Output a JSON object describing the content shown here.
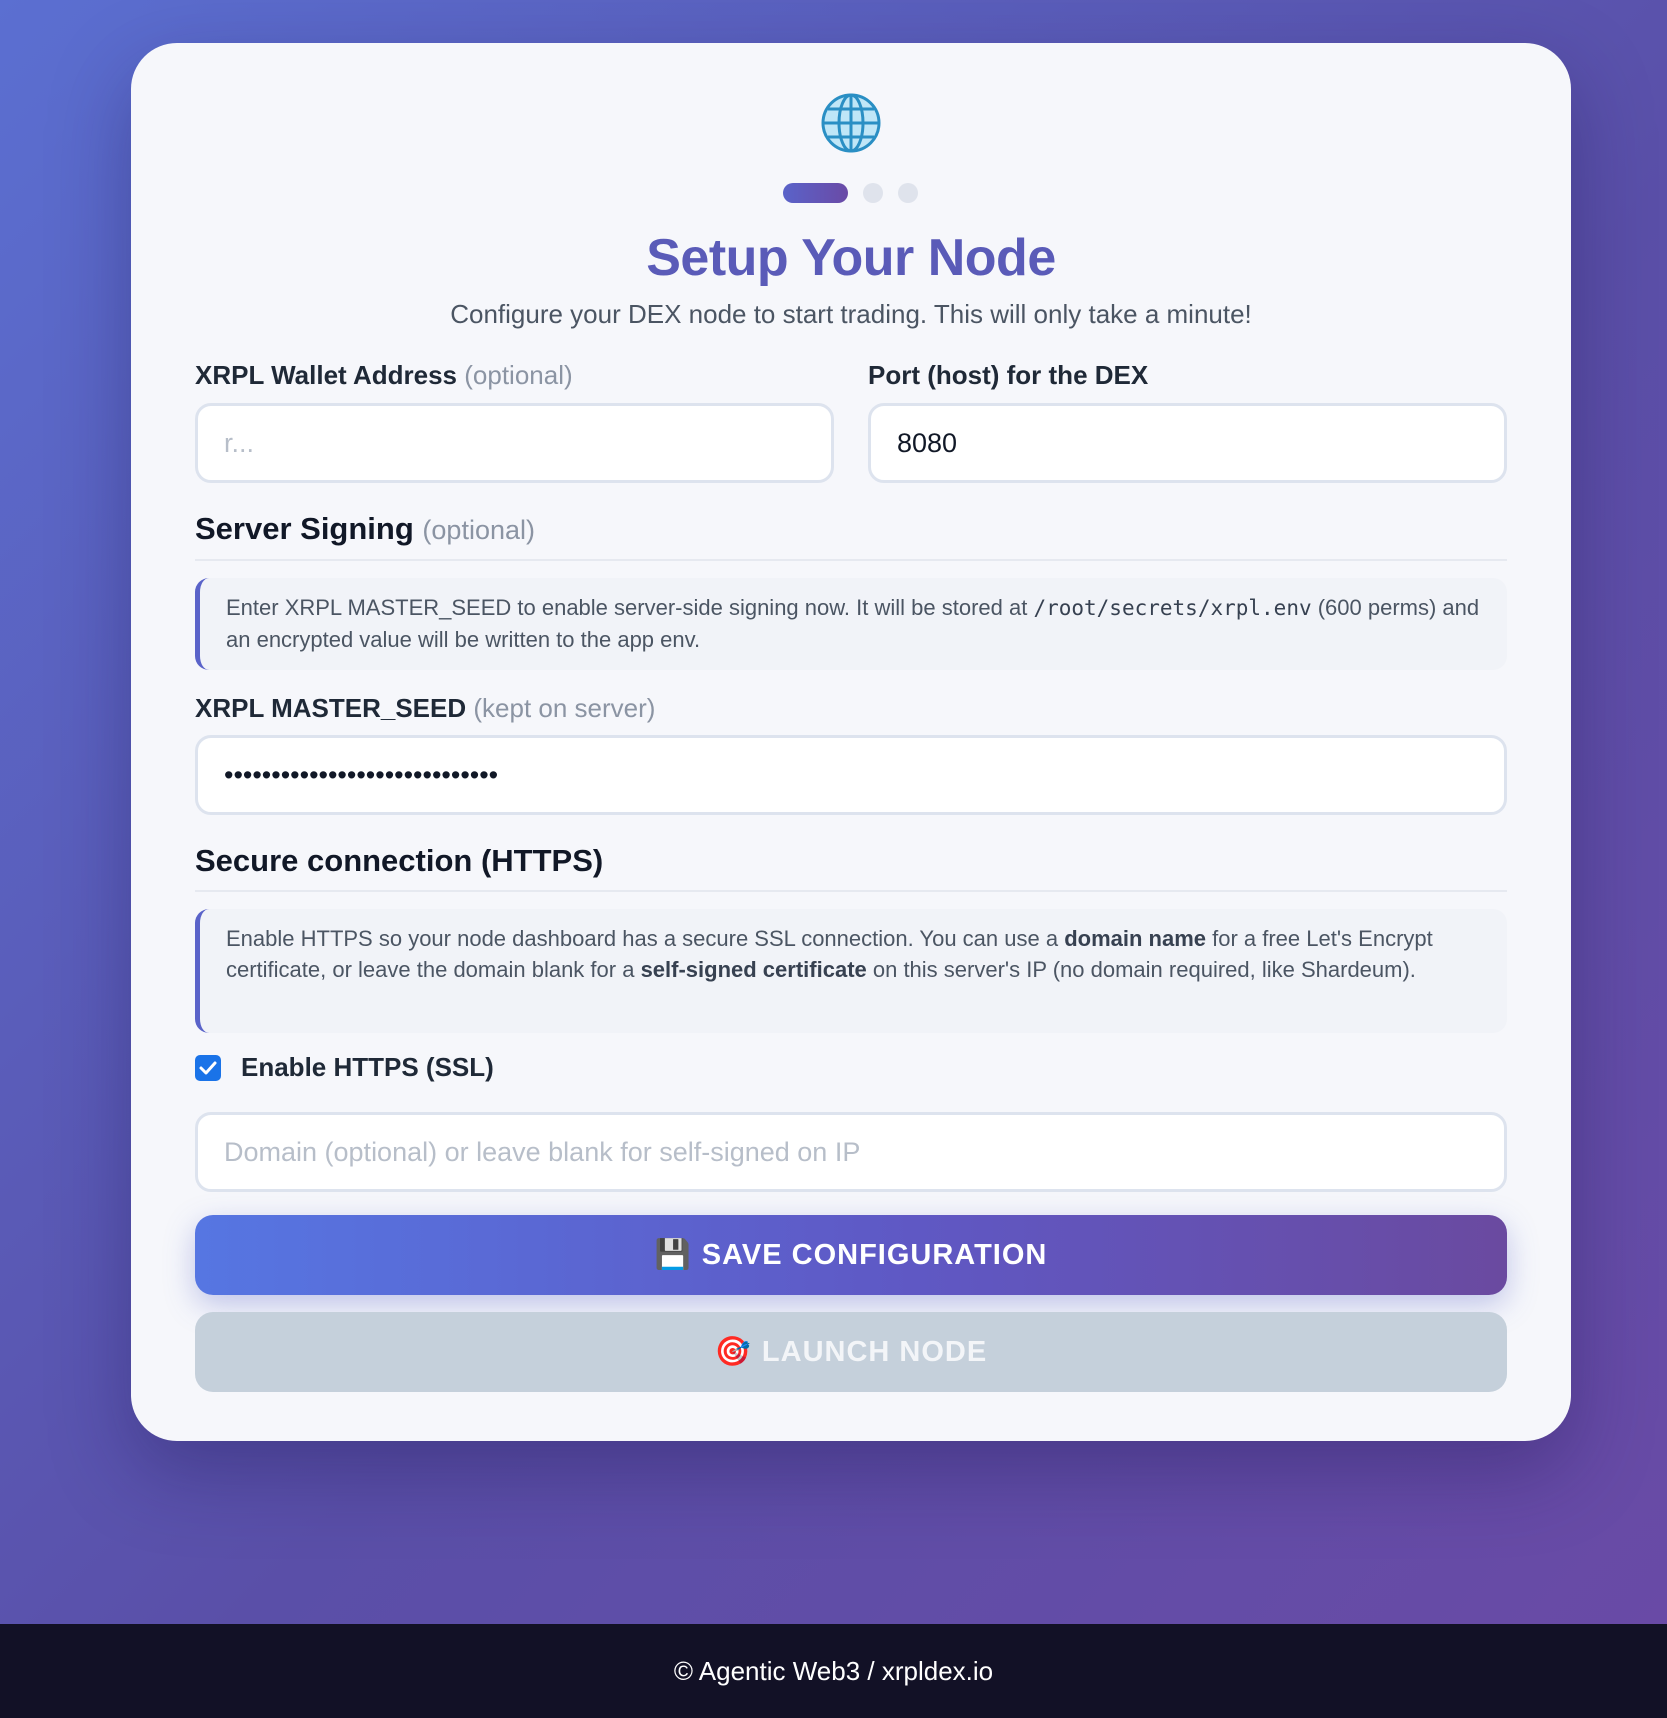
{
  "header": {
    "icon": "globe-icon",
    "title": "Setup Your Node",
    "subtitle": "Configure your DEX node to start trading. This will only take a minute!",
    "steps_total": 3,
    "steps_active": 1
  },
  "form": {
    "wallet": {
      "label": "XRPL Wallet Address",
      "hint": "(optional)",
      "placeholder": "r...",
      "value": ""
    },
    "port": {
      "label": "Port (host) for the DEX",
      "value": "8080"
    },
    "signing": {
      "title": "Server Signing",
      "hint": "(optional)",
      "notice_pre": "Enter XRPL MASTER_SEED to enable server-side signing now. It will be stored at ",
      "notice_path": "/root/secrets/xrpl.env",
      "notice_post": " (600 perms) and an encrypted value will be written to the app env.",
      "seed_label": "XRPL MASTER_SEED",
      "seed_hint": "(kept on server)",
      "seed_value": "sXXXXXXXXXXXXXXXXXXXXXXXXXXXX"
    },
    "https": {
      "title": "Secure connection (HTTPS)",
      "notice_1": "Enable HTTPS so your node dashboard has a secure SSL connection. You can use a ",
      "notice_b1": "domain name",
      "notice_2": " for a free Let's Encrypt certificate, or leave the domain blank for a ",
      "notice_b2": "self-signed certificate",
      "notice_3": " on this server's IP (no domain required, like Shardeum).",
      "checkbox_label": "Enable HTTPS (SSL)",
      "checked": true,
      "domain_placeholder": "Domain (optional) or leave blank for self-signed on IP"
    }
  },
  "buttons": {
    "save": {
      "icon": "floppy-disk-icon",
      "glyph": "💾",
      "label": "SAVE CONFIGURATION"
    },
    "launch": {
      "icon": "target-icon",
      "glyph": "🎯",
      "label": "LAUNCH NODE"
    }
  },
  "footer": {
    "text": "© Agentic Web3 / xrpldex.io"
  },
  "colors": {
    "accent": "#5a5bb8",
    "checkbox": "#1a73e8",
    "footer_bg": "#121126"
  }
}
